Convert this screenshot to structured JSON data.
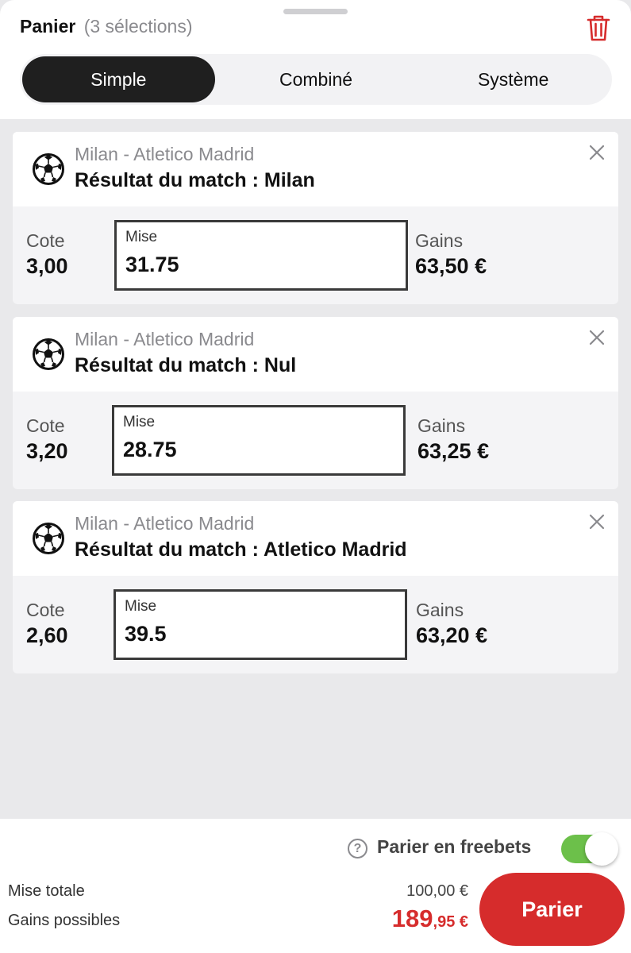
{
  "header": {
    "title": "Panier",
    "count_label": "(3 sélections)",
    "trash_icon": "trash-icon"
  },
  "tabs": [
    {
      "label": "Simple",
      "active": true
    },
    {
      "label": "Combiné",
      "active": false
    },
    {
      "label": "Système",
      "active": false
    }
  ],
  "bets": [
    {
      "icon": "soccer-ball-icon",
      "match": "Milan - Atletico Madrid",
      "result": "Résultat du match : Milan",
      "cote_label": "Cote",
      "cote": "3,00",
      "mise_label": "Mise",
      "mise": "31.75",
      "gains_label": "Gains",
      "gains": "63,50 €"
    },
    {
      "icon": "soccer-ball-icon",
      "match": "Milan - Atletico Madrid",
      "result": "Résultat du match : Nul",
      "cote_label": "Cote",
      "cote": "3,20",
      "mise_label": "Mise",
      "mise": "28.75",
      "gains_label": "Gains",
      "gains": "63,25 €"
    },
    {
      "icon": "soccer-ball-icon",
      "match": "Milan - Atletico Madrid",
      "result": "Résultat du match : Atletico Madrid",
      "cote_label": "Cote",
      "cote": "2,60",
      "mise_label": "Mise",
      "mise": "39.5",
      "gains_label": "Gains",
      "gains": "63,20 €"
    }
  ],
  "footer": {
    "help_icon": "question-icon",
    "help_glyph": "?",
    "freebets_label": "Parier en freebets",
    "freebets_enabled": true,
    "mise_totale_label": "Mise totale",
    "mise_totale_value": "100,00 €",
    "gains_possibles_label": "Gains possibles",
    "gains_possibles_int": "189",
    "gains_possibles_dec": ",95 €",
    "parier_label": "Parier"
  },
  "colors": {
    "accent_red": "#d62c2c",
    "toggle_green": "#6cc04a",
    "active_tab": "#1f1f1f"
  }
}
